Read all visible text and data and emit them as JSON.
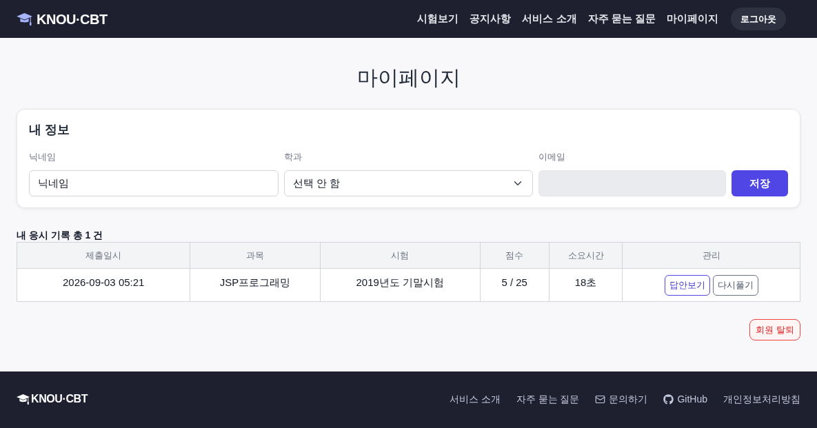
{
  "header": {
    "brand": "KNOU·CBT",
    "nav": [
      "시험보기",
      "공지사항",
      "서비스 소개",
      "자주 묻는 질문",
      "마이페이지"
    ],
    "logout_button": "로그아웃"
  },
  "page_title": "마이페이지",
  "profile_card": {
    "title": "내 정보",
    "fields": [
      {
        "kind": "text",
        "label": "닉네임",
        "value": "닉네임",
        "disabled": false
      },
      {
        "kind": "select",
        "label": "학과",
        "value": "선택 안 함",
        "disabled": false
      },
      {
        "kind": "text",
        "label": "이메일",
        "disabled": true
      }
    ],
    "save_button": "저장"
  },
  "history": {
    "title": "내 응시 기록 총 1 건",
    "columns": [
      "제출일시",
      "과목",
      "시험",
      "점수",
      "소요시간",
      "관리"
    ],
    "rows": [
      {
        "cells": [
          "2026-09-03 05:21",
          "JSP프로그래밍",
          "2019년도 기말시험",
          "5 / 25",
          "18초"
        ],
        "actions": [
          {
            "kind": "primary",
            "label": "답안보기"
          },
          {
            "kind": "secondary",
            "label": "다시풀기"
          }
        ]
      }
    ]
  },
  "withdraw_button": "회원 탈퇴",
  "footer": {
    "brand": "KNOU·CBT",
    "links": [
      {
        "kind": "plain",
        "label": "서비스 소개"
      },
      {
        "kind": "plain",
        "label": "자주 묻는 질문"
      },
      {
        "kind": "mail",
        "label": "문의하기"
      },
      {
        "kind": "github",
        "label": "GitHub"
      },
      {
        "kind": "plain",
        "label": "개인정보처리방침"
      }
    ]
  }
}
